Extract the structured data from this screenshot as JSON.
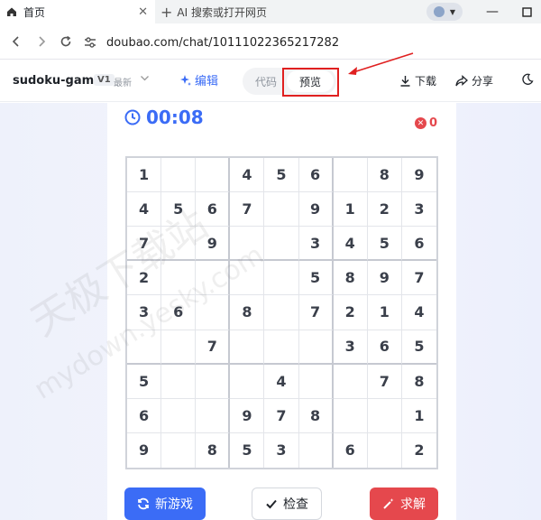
{
  "browser": {
    "tabs": [
      {
        "label": "首页",
        "icon": "home-icon"
      },
      {
        "label": "AI 搜索或打开网页",
        "icon": "plus-icon"
      }
    ],
    "url": "doubao.com/chat/10111022365217282"
  },
  "header": {
    "project_name": "sudoku-game",
    "version": "V1",
    "version_tag": "最新",
    "edit_label": "编辑",
    "tabs": {
      "code": "代码",
      "preview": "预览"
    },
    "download_label": "下载",
    "share_label": "分享"
  },
  "game": {
    "timer": "00:08",
    "mistakes": "0",
    "grid": [
      [
        "1",
        "",
        "",
        "4",
        "5",
        "6",
        "",
        "8",
        "9"
      ],
      [
        "4",
        "5",
        "6",
        "7",
        "",
        "9",
        "1",
        "2",
        "3"
      ],
      [
        "7",
        "",
        "9",
        "",
        "",
        "3",
        "4",
        "5",
        "6"
      ],
      [
        "2",
        "",
        "",
        "",
        "",
        "5",
        "8",
        "9",
        "7"
      ],
      [
        "3",
        "6",
        "",
        "8",
        "",
        "7",
        "2",
        "1",
        "4"
      ],
      [
        "",
        "",
        "7",
        "",
        "",
        "",
        "3",
        "6",
        "5"
      ],
      [
        "5",
        "",
        "",
        "",
        "4",
        "",
        "",
        "7",
        "8"
      ],
      [
        "6",
        "",
        "",
        "9",
        "7",
        "8",
        "",
        "",
        "1"
      ],
      [
        "9",
        "",
        "8",
        "5",
        "3",
        "",
        "6",
        "",
        "2"
      ]
    ],
    "buttons": {
      "new_game": "新游戏",
      "check": "检查",
      "solve": "求解"
    }
  },
  "watermark": {
    "line1": "天极下载站",
    "line2": "mydown.yesky.com"
  },
  "colors": {
    "accent": "#3b6cf6",
    "danger": "#e5484d",
    "highlight": "#e02020"
  }
}
